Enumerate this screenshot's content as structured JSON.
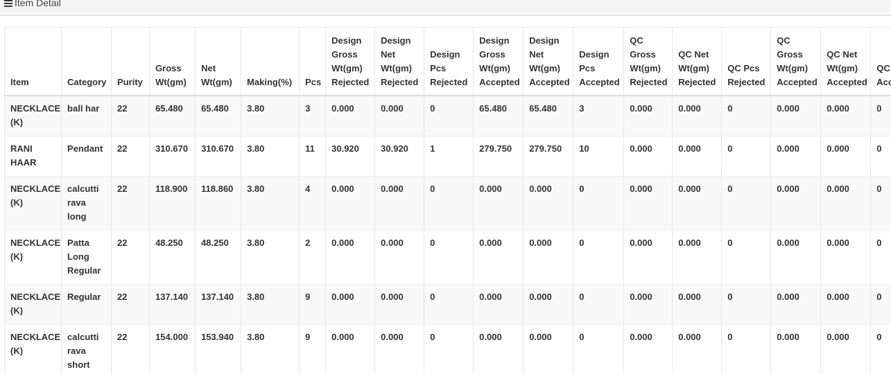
{
  "panel": {
    "title": "Item Detail",
    "icon": "menu-icon"
  },
  "table": {
    "columns": [
      "Item",
      "Category",
      "Purity",
      "Gross Wt(gm)",
      "Net Wt(gm)",
      "Making(%)",
      "Pcs",
      "Design Gross Wt(gm) Rejected",
      "Design Net Wt(gm) Rejected",
      "Design Pcs Rejected",
      "Design Gross Wt(gm) Accepted",
      "Design Net Wt(gm) Accepted",
      "Design Pcs Accepted",
      "QC Gross Wt(gm) Rejected",
      "QC Net Wt(gm) Rejected",
      "QC Pcs Rejected",
      "QC Gross Wt(gm) Accepted",
      "QC Net Wt(gm) Accepted",
      "QC Acc"
    ],
    "rows": [
      [
        "NECKLACE (K)",
        "ball har",
        "22",
        "65.480",
        "65.480",
        "3.80",
        "3",
        "0.000",
        "0.000",
        "0",
        "65.480",
        "65.480",
        "3",
        "0.000",
        "0.000",
        "0",
        "0.000",
        "0.000",
        "0"
      ],
      [
        "RANI HAAR",
        "Pendant",
        "22",
        "310.670",
        "310.670",
        "3.80",
        "11",
        "30.920",
        "30.920",
        "1",
        "279.750",
        "279.750",
        "10",
        "0.000",
        "0.000",
        "0",
        "0.000",
        "0.000",
        "0"
      ],
      [
        "NECKLACE (K)",
        "calcutti rava long",
        "22",
        "118.900",
        "118.860",
        "3.80",
        "4",
        "0.000",
        "0.000",
        "0",
        "0.000",
        "0.000",
        "0",
        "0.000",
        "0.000",
        "0",
        "0.000",
        "0.000",
        "0"
      ],
      [
        "NECKLACE (K)",
        "Patta Long Regular",
        "22",
        "48.250",
        "48.250",
        "3.80",
        "2",
        "0.000",
        "0.000",
        "0",
        "0.000",
        "0.000",
        "0",
        "0.000",
        "0.000",
        "0",
        "0.000",
        "0.000",
        "0"
      ],
      [
        "NECKLACE (K)",
        "Regular",
        "22",
        "137.140",
        "137.140",
        "3.80",
        "9",
        "0.000",
        "0.000",
        "0",
        "0.000",
        "0.000",
        "0",
        "0.000",
        "0.000",
        "0",
        "0.000",
        "0.000",
        "0"
      ],
      [
        "NECKLACE (K)",
        "calcutti rava short",
        "22",
        "154.000",
        "153.940",
        "3.80",
        "9",
        "0.000",
        "0.000",
        "0",
        "0.000",
        "0.000",
        "0",
        "0.000",
        "0.000",
        "0",
        "0.000",
        "0.000",
        "0"
      ]
    ]
  }
}
